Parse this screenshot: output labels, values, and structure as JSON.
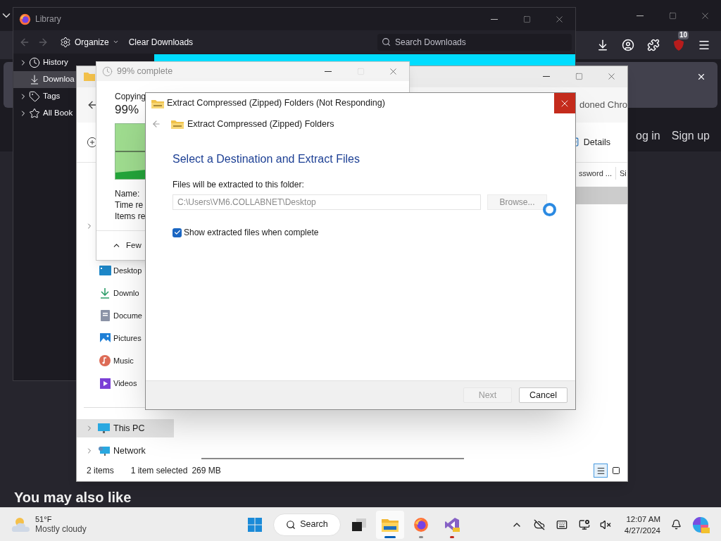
{
  "browser": {
    "badge": "10",
    "links": [
      {
        "label": "og in"
      },
      {
        "label": "Sign up"
      }
    ],
    "heading": "You may also like"
  },
  "library": {
    "title": "Library",
    "organize": "Organize",
    "clear": "Clear Downloads",
    "search_placeholder": "Search Downloads",
    "sidebar": [
      {
        "label": "History",
        "expandable": true,
        "selected": false
      },
      {
        "label": "Downloa",
        "expandable": false,
        "selected": true
      },
      {
        "label": "Tags",
        "expandable": true,
        "selected": false
      },
      {
        "label": "All Book",
        "expandable": true,
        "selected": false
      }
    ]
  },
  "explorer": {
    "address_text": "doned Chro",
    "details": "Details",
    "columns": [
      "ssword ...",
      "Si"
    ],
    "quick_access": [
      {
        "label": "Desktop"
      },
      {
        "label": "Downlo"
      },
      {
        "label": "Docume"
      },
      {
        "label": "Pictures"
      },
      {
        "label": "Music"
      },
      {
        "label": "Videos"
      }
    ],
    "tree": [
      {
        "label": "This PC",
        "selected": true
      },
      {
        "label": "Network",
        "selected": false
      }
    ],
    "status": {
      "count": "2 items",
      "selection": "1 item selected",
      "size": "269 MB"
    },
    "views": [
      {
        "selected": true
      },
      {
        "selected": false
      }
    ]
  },
  "copy": {
    "title": "99% complete",
    "heading": "Copying",
    "percent": "99%",
    "details": [
      "Name:",
      "Time re",
      "Items re"
    ],
    "toggle": "Few"
  },
  "extract": {
    "title": "Extract Compressed (Zipped) Folders (Not Responding)",
    "subtitle": "Extract Compressed (Zipped) Folders",
    "heading": "Select a Destination and Extract Files",
    "field_label": "Files will be extracted to this folder:",
    "path": {
      "value": "C:\\Users\\VM6.COLLABNET\\Desktop",
      "disabled": true
    },
    "browse": {
      "label": "Browse...",
      "disabled": true
    },
    "show_files": {
      "label": "Show extracted files when complete",
      "checked": true
    },
    "buttons": [
      {
        "label": "Next",
        "disabled": true
      },
      {
        "label": "Cancel",
        "disabled": false
      }
    ]
  },
  "taskbar": {
    "weather": {
      "temp": "51°F",
      "condition": "Mostly cloudy"
    },
    "search": "Search",
    "apps": [
      {
        "kind": "idle"
      },
      {
        "kind": "active"
      },
      {
        "kind": "running"
      },
      {
        "kind": "attention"
      }
    ],
    "time": "12:07 AM",
    "date": "4/27/2024"
  }
}
